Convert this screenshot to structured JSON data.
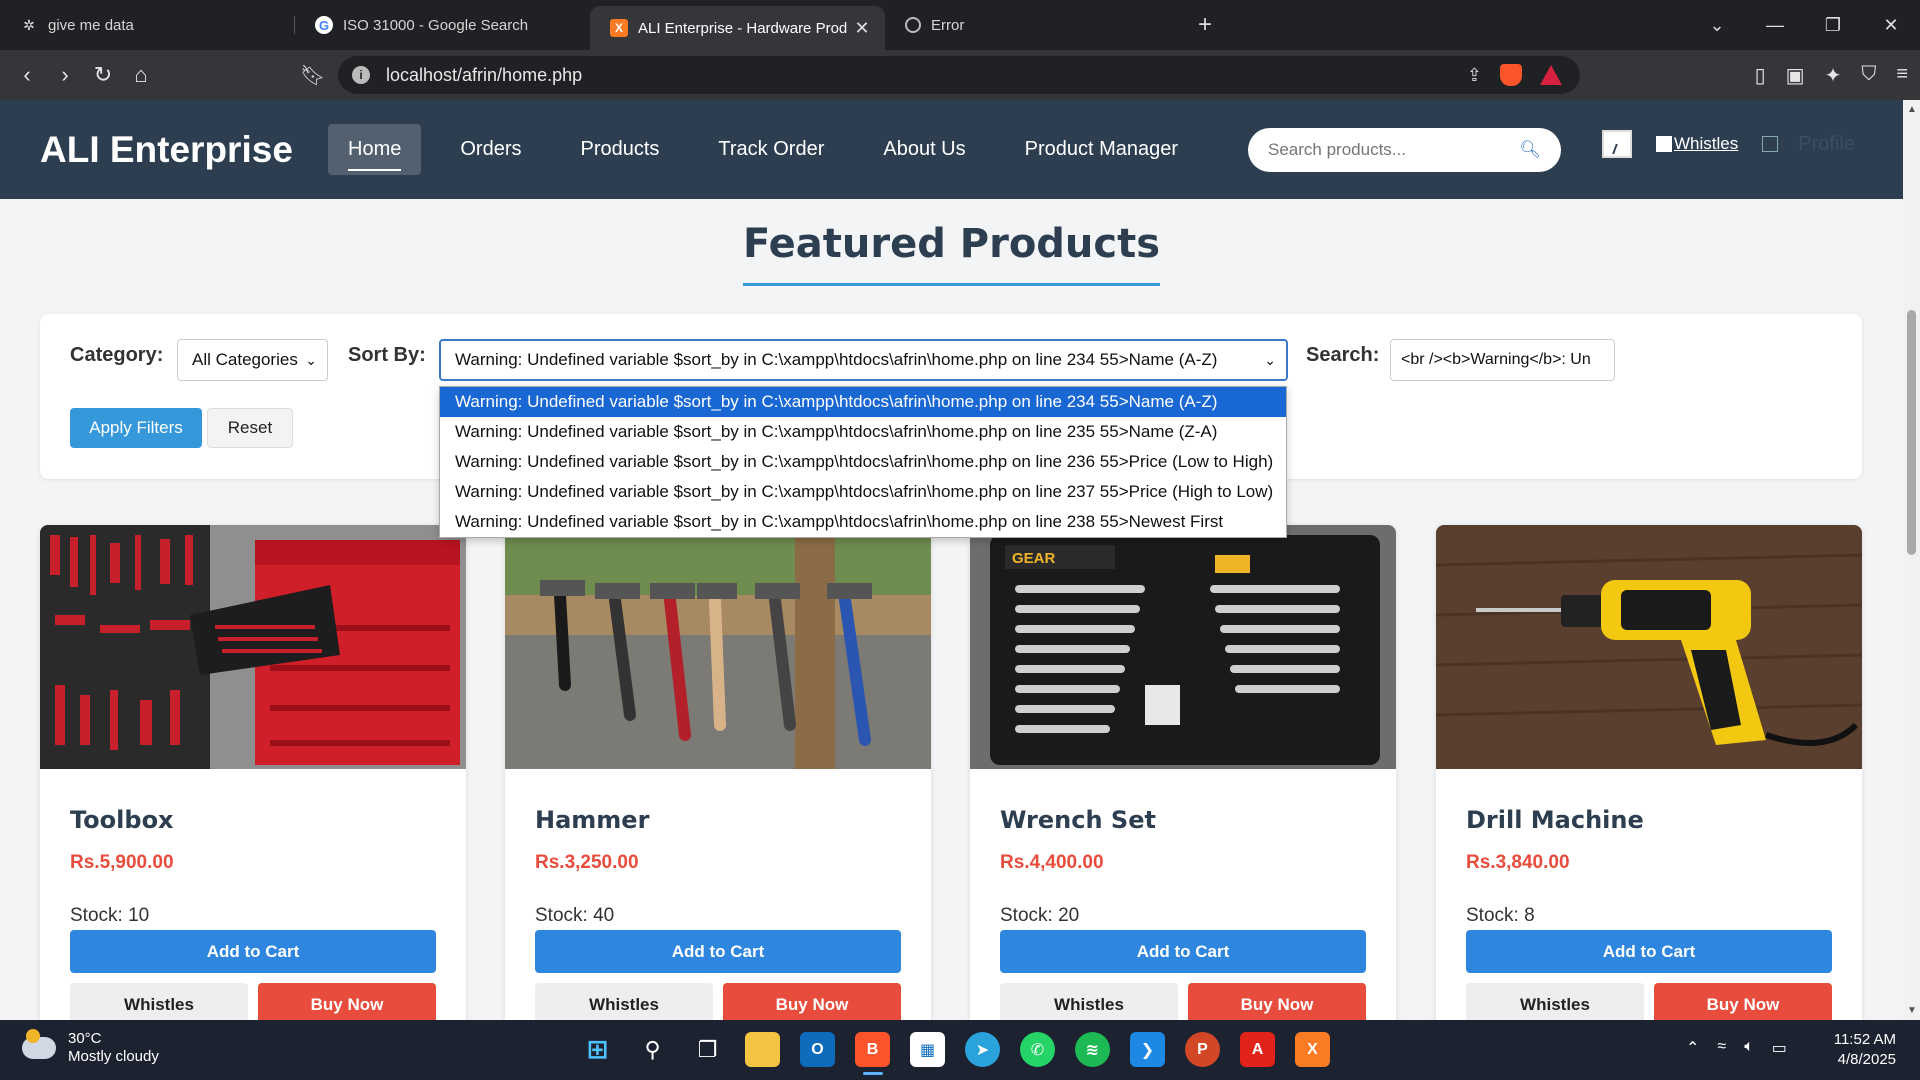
{
  "browser": {
    "tabs": [
      {
        "title": "give me data",
        "icon": "openai-icon"
      },
      {
        "title": "ISO 31000 - Google Search",
        "icon": "google-icon"
      },
      {
        "title": "ALI Enterprise - Hardware Prod",
        "icon": "xampp-icon",
        "active": true
      },
      {
        "title": "Error",
        "icon": "globe-icon"
      }
    ],
    "url": "localhost/afrin/home.php"
  },
  "site": {
    "brand": "ALI Enterprise",
    "nav": [
      "Home",
      "Orders",
      "Products",
      "Track Order",
      "About Us",
      "Product Manager"
    ],
    "search_placeholder": "Search products...",
    "whistles_link": "Whistles",
    "profile_alt": "Profile"
  },
  "main": {
    "heading": "Featured Products",
    "filters": {
      "category_label": "Category:",
      "category_value": "All Categories",
      "sort_label": "Sort By:",
      "sort_value": "Warning: Undefined variable $sort_by in C:\\xampp\\htdocs\\afrin\\home.php on line 234 55>Name (A-Z)",
      "sort_options": [
        "Warning: Undefined variable $sort_by in C:\\xampp\\htdocs\\afrin\\home.php on line 234 55>Name (A-Z)",
        "Warning: Undefined variable $sort_by in C:\\xampp\\htdocs\\afrin\\home.php on line 235 55>Name (Z-A)",
        "Warning: Undefined variable $sort_by in C:\\xampp\\htdocs\\afrin\\home.php on line 236 55>Price (Low to High)",
        "Warning: Undefined variable $sort_by in C:\\xampp\\htdocs\\afrin\\home.php on line 237 55>Price (High to Low)",
        "Warning: Undefined variable $sort_by in C:\\xampp\\htdocs\\afrin\\home.php on line 238 55>Newest First"
      ],
      "search_label": "Search:",
      "search_value": "<br /><b>Warning</b>:  Un",
      "apply_label": "Apply Filters",
      "reset_label": "Reset"
    },
    "products": [
      {
        "name": "Toolbox",
        "price": "Rs.5,900.00",
        "stock": "Stock: 10"
      },
      {
        "name": "Hammer",
        "price": "Rs.3,250.00",
        "stock": "Stock: 40"
      },
      {
        "name": "Wrench Set",
        "price": "Rs.4,400.00",
        "stock": "Stock: 20"
      },
      {
        "name": "Drill Machine",
        "price": "Rs.3,840.00",
        "stock": "Stock: 8"
      }
    ],
    "card_buttons": {
      "cart": "Add to Cart",
      "whistles": "Whistles",
      "buy": "Buy Now"
    }
  },
  "taskbar": {
    "weather_temp": "30°C",
    "weather_desc": "Mostly cloudy",
    "time": "11:52 AM",
    "date": "4/8/2025"
  },
  "colors": {
    "header": "#2c3e50",
    "accent": "#3498db",
    "price": "#e74c3c"
  }
}
